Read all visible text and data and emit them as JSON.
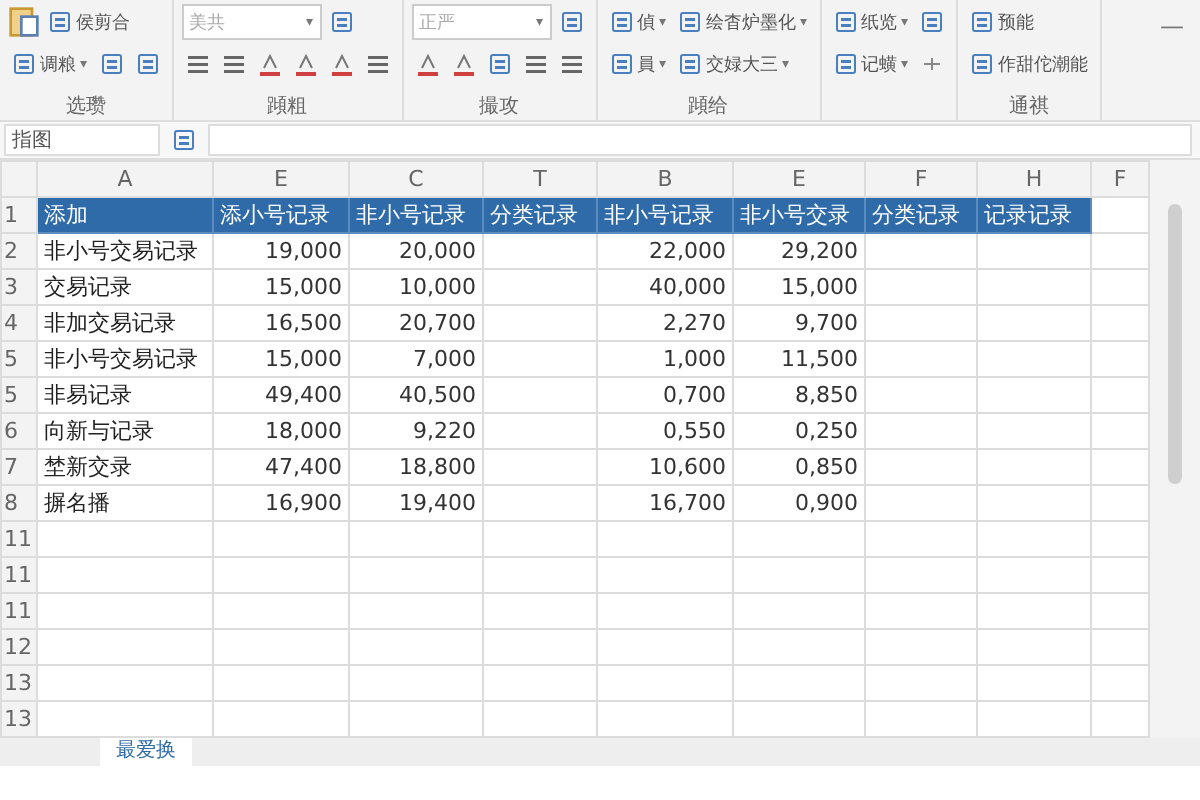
{
  "ribbon": {
    "groups": [
      {
        "label": "选瓒",
        "rows": [
          [
            {
              "kind": "icon"
            },
            {
              "kind": "small",
              "label": "侯剪合"
            }
          ],
          [
            {
              "kind": "small",
              "label": "调粮",
              "caret": "▾"
            },
            {
              "kind": "icon"
            },
            {
              "kind": "icon"
            }
          ]
        ]
      },
      {
        "label": "蹞粗",
        "rows": [
          [
            {
              "kind": "field",
              "value": "美共",
              "caret": "▾"
            },
            {
              "kind": "icon"
            }
          ],
          [
            {
              "kind": "icon"
            },
            {
              "kind": "icon"
            },
            {
              "kind": "icon"
            },
            {
              "kind": "icon"
            },
            {
              "kind": "icon"
            },
            {
              "kind": "icon"
            }
          ]
        ]
      },
      {
        "label": "撮攻",
        "rows": [
          [
            {
              "kind": "field",
              "value": "正严",
              "caret": "▾"
            },
            {
              "kind": "icon"
            }
          ],
          [
            {
              "kind": "icon"
            },
            {
              "kind": "icon"
            },
            {
              "kind": "icon"
            },
            {
              "kind": "icon"
            },
            {
              "kind": "icon"
            }
          ]
        ]
      },
      {
        "label": "蹞给",
        "rows": [
          [
            {
              "kind": "small",
              "label": "偵",
              "caret": "▾"
            },
            {
              "kind": "small",
              "label": "绘杳炉墨化",
              "caret": "▾"
            }
          ],
          [
            {
              "kind": "small",
              "label": "員",
              "caret": "▾"
            },
            {
              "kind": "small",
              "label": "交娽大三",
              "caret": "▾"
            }
          ]
        ]
      },
      {
        "rows": [
          [
            {
              "kind": "small",
              "label": "纸览",
              "caret": "▾"
            },
            {
              "kind": "icon"
            }
          ],
          [
            {
              "kind": "small",
              "label": "记蟥",
              "caret": "▾"
            },
            {
              "kind": "icon"
            }
          ]
        ]
      },
      {
        "label": "通祺",
        "rows": [
          [
            {
              "kind": "small",
              "label": "预能"
            }
          ],
          [
            {
              "kind": "small",
              "label": "作甜佗潮能"
            }
          ]
        ]
      }
    ],
    "minimize": "—"
  },
  "name_box": "指图",
  "columns": [
    "A",
    "E",
    "C",
    "T",
    "B",
    "E",
    "F",
    "H",
    "F"
  ],
  "header_row": {
    "number": "1",
    "cells": [
      "添加",
      "添小号记录",
      "非小号记录",
      "分类记录",
      "非小号记录",
      "非小号交录",
      "分类记录",
      "记录记录"
    ]
  },
  "rows": [
    {
      "number": "2",
      "cells": [
        "非小号交易记录",
        "19,000",
        "20,000",
        "",
        "22,000",
        "29,200",
        "",
        "",
        ""
      ]
    },
    {
      "number": "3",
      "cells": [
        "交易记录",
        "15,000",
        "10,000",
        "",
        "40,000",
        "15,000",
        "",
        "",
        ""
      ]
    },
    {
      "number": "4",
      "cells": [
        "非加交易记录",
        "16,500",
        "20,700",
        "",
        "2,270",
        "9,700",
        "",
        "",
        ""
      ]
    },
    {
      "number": "5",
      "cells": [
        "非小号交易记录",
        "15,000",
        "7,000",
        "",
        "1,000",
        "11,500",
        "",
        "",
        ""
      ]
    },
    {
      "number": "5",
      "cells": [
        "非易记录",
        "49,400",
        "40,500",
        "",
        "0,700",
        "8,850",
        "",
        "",
        ""
      ]
    },
    {
      "number": "6",
      "cells": [
        "向新与记录",
        "18,000",
        "9,220",
        "",
        "0,550",
        "0,250",
        "",
        "",
        ""
      ]
    },
    {
      "number": "7",
      "cells": [
        "埜新交录",
        "47,400",
        "18,800",
        "",
        "10,600",
        "0,850",
        "",
        "",
        ""
      ]
    },
    {
      "number": "8",
      "cells": [
        "摒名播",
        "16,900",
        "19,400",
        "",
        "16,700",
        "0,900",
        "",
        "",
        ""
      ]
    },
    {
      "number": "11",
      "cells": [
        "",
        "",
        "",
        "",
        "",
        "",
        "",
        "",
        ""
      ]
    },
    {
      "number": "11",
      "cells": [
        "",
        "",
        "",
        "",
        "",
        "",
        "",
        "",
        ""
      ]
    },
    {
      "number": "11",
      "cells": [
        "",
        "",
        "",
        "",
        "",
        "",
        "",
        "",
        ""
      ]
    },
    {
      "number": "12",
      "cells": [
        "",
        "",
        "",
        "",
        "",
        "",
        "",
        "",
        ""
      ]
    },
    {
      "number": "13",
      "cells": [
        "",
        "",
        "",
        "",
        "",
        "",
        "",
        "",
        ""
      ]
    },
    {
      "number": "13",
      "cells": [
        "",
        "",
        "",
        "",
        "",
        "",
        "",
        "",
        ""
      ]
    }
  ],
  "sheet_tabs": [
    {
      "label": "最爱换",
      "selected": true
    }
  ]
}
